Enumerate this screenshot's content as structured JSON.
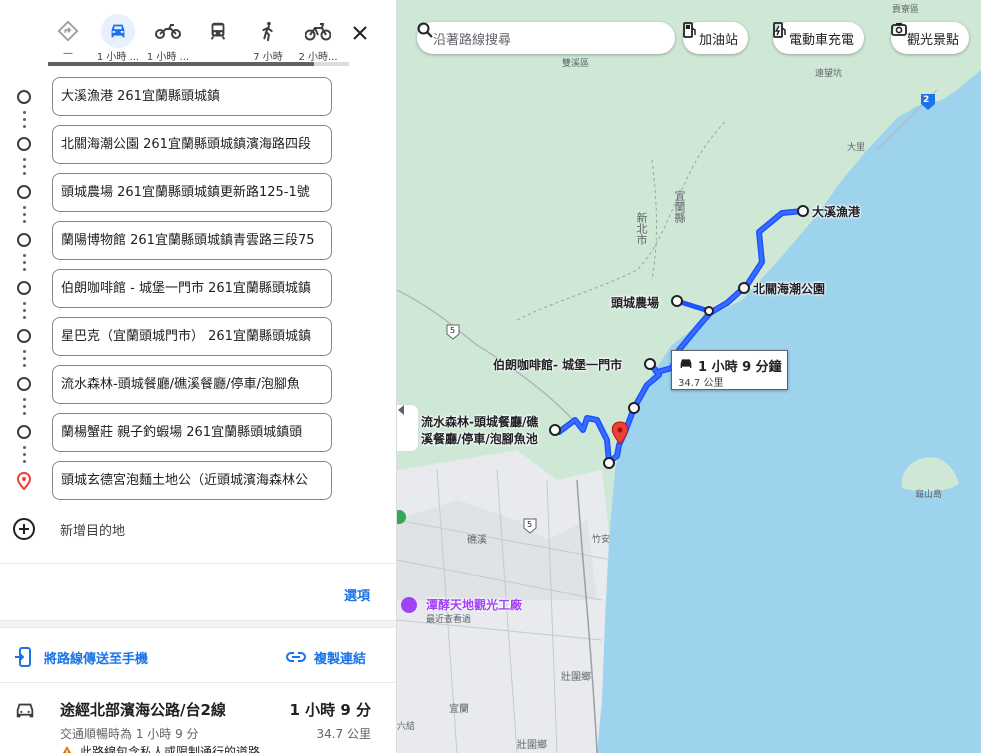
{
  "travel_modes": [
    {
      "name": "best",
      "label": "—"
    },
    {
      "name": "car",
      "label": "1 小時 ..."
    },
    {
      "name": "motorcycle",
      "label": "1 小時 ..."
    },
    {
      "name": "transit",
      "label": ""
    },
    {
      "name": "walk",
      "label": "7 小時"
    },
    {
      "name": "bicycle",
      "label": "2 小時..."
    }
  ],
  "stops": [
    "大溪漁港 261宜蘭縣頭城鎮",
    "北關海潮公園 261宜蘭縣頭城鎮濱海路四段",
    "頭城農場 261宜蘭縣頭城鎮更新路125-1號",
    "蘭陽博物館 261宜蘭縣頭城鎮青雲路三段75",
    "伯朗咖啡館 - 城堡一門市 261宜蘭縣頭城鎮",
    "星巴克（宜蘭頭城門市） 261宜蘭縣頭城鎮",
    "流水森林-頭城餐廳/礁溪餐廳/停車/泡腳魚",
    "蘭楊蟹莊 親子釣蝦場 261宜蘭縣頭城鎮頭",
    "頭城玄德宮泡麵土地公（近頭城濱海森林公"
  ],
  "add_destination": "新增目的地",
  "options_label": "選項",
  "send_to_phone": "將路線傳送至手機",
  "copy_link": "複製連結",
  "route": {
    "title": "途經北部濱海公路/台2線",
    "time": "1 小時 9 分",
    "subtitle": "交通順暢時為 1 小時 9 分",
    "distance": "34.7 公里",
    "warning": "此路線包含私人或限制通行的道路"
  },
  "map": {
    "search_placeholder": "沿著路線搜尋",
    "chips": [
      "加油站",
      "電動車充電",
      "觀光景點"
    ],
    "route_box": {
      "time": "1 小時 9 分鐘",
      "distance": "34.7 公里"
    },
    "place_labels": {
      "daxi": "大溪漁港",
      "beiguan": "北關海潮公園",
      "farm": "頭城農場",
      "cafe": "伯朗咖啡館- 城堡一門市",
      "forest_line1": "流水森林-頭城餐廳/礁",
      "forest_line2": "溪餐廳/停車/泡腳魚池",
      "winery": "潭酵天地觀光工廠",
      "winery_sub": "最近查看過"
    },
    "area_labels": {
      "gongliao": "貢寮區",
      "shuangxi": "雙溪區",
      "yuanwangkeng": "遠望坑",
      "dali": "大里",
      "yilan_county": "宜蘭縣",
      "new_taipei": "新北市",
      "jiaoxi": "礁溪",
      "zhuan": "竹安",
      "zhuangwei1": "壯圍鄉",
      "zhuangwei2": "壯圍鄉",
      "yilan": "宜蘭",
      "guishan": "龜山島",
      "liujie": "六結"
    },
    "road_shields": {
      "r2": "2",
      "r5a": "5",
      "r5b": "5"
    },
    "colors": {
      "route": "#1a53ff",
      "water": "#9ed3ee",
      "land": "#cfe8d6",
      "pin": "#ea4335"
    }
  }
}
